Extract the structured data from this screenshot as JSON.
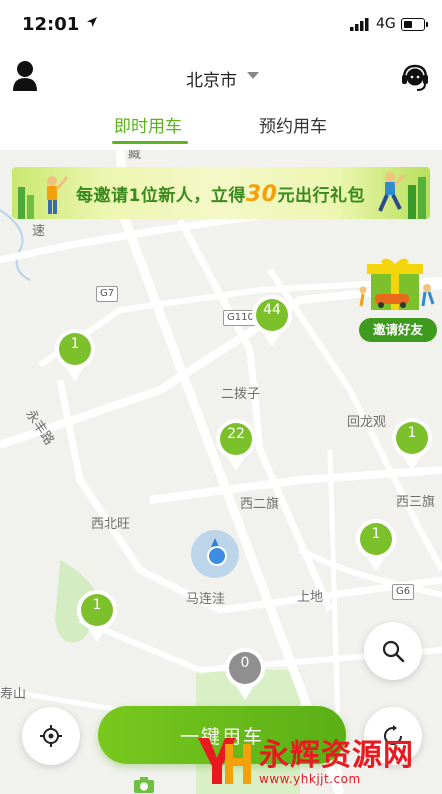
{
  "status_bar": {
    "time": "12:01",
    "network": "4G"
  },
  "header": {
    "city": "北京市",
    "tabs": [
      {
        "label": "即时用车",
        "active": true
      },
      {
        "label": "预约用车",
        "active": false
      }
    ]
  },
  "banner": {
    "text_before": "每邀请1位新人，立得",
    "amount": "30",
    "text_after": "元出行礼包"
  },
  "invite_widget": {
    "label": "邀请好友"
  },
  "map": {
    "places": [
      "藏",
      "速",
      "永丰路",
      "二拨子",
      "回龙观",
      "西二旗",
      "西三旗",
      "西北旺",
      "马连洼",
      "上地",
      "寿山"
    ],
    "road_shields": [
      "G7",
      "G110",
      "G6"
    ]
  },
  "car_clusters": [
    {
      "count": "1",
      "status": "available"
    },
    {
      "count": "44",
      "status": "available"
    },
    {
      "count": "22",
      "status": "available"
    },
    {
      "count": "1",
      "status": "available"
    },
    {
      "count": "1",
      "status": "available"
    },
    {
      "count": "1",
      "status": "available"
    },
    {
      "count": "0",
      "status": "empty"
    }
  ],
  "action": {
    "primary_button": "一键用车"
  },
  "watermark": {
    "title": "永辉资源网",
    "url": "www.yhkjjt.com"
  },
  "colors": {
    "accent": "#5fb31e",
    "pin_green": "#7cc12b",
    "pin_gray": "#8f8f8f",
    "watermark_red": "#e8191f"
  },
  "icons": [
    "location-arrow-icon",
    "signal-icon",
    "battery-icon",
    "user-icon",
    "customer-service-icon",
    "caret-down-icon",
    "locate-icon",
    "search-icon",
    "refresh-icon",
    "camera-icon"
  ]
}
